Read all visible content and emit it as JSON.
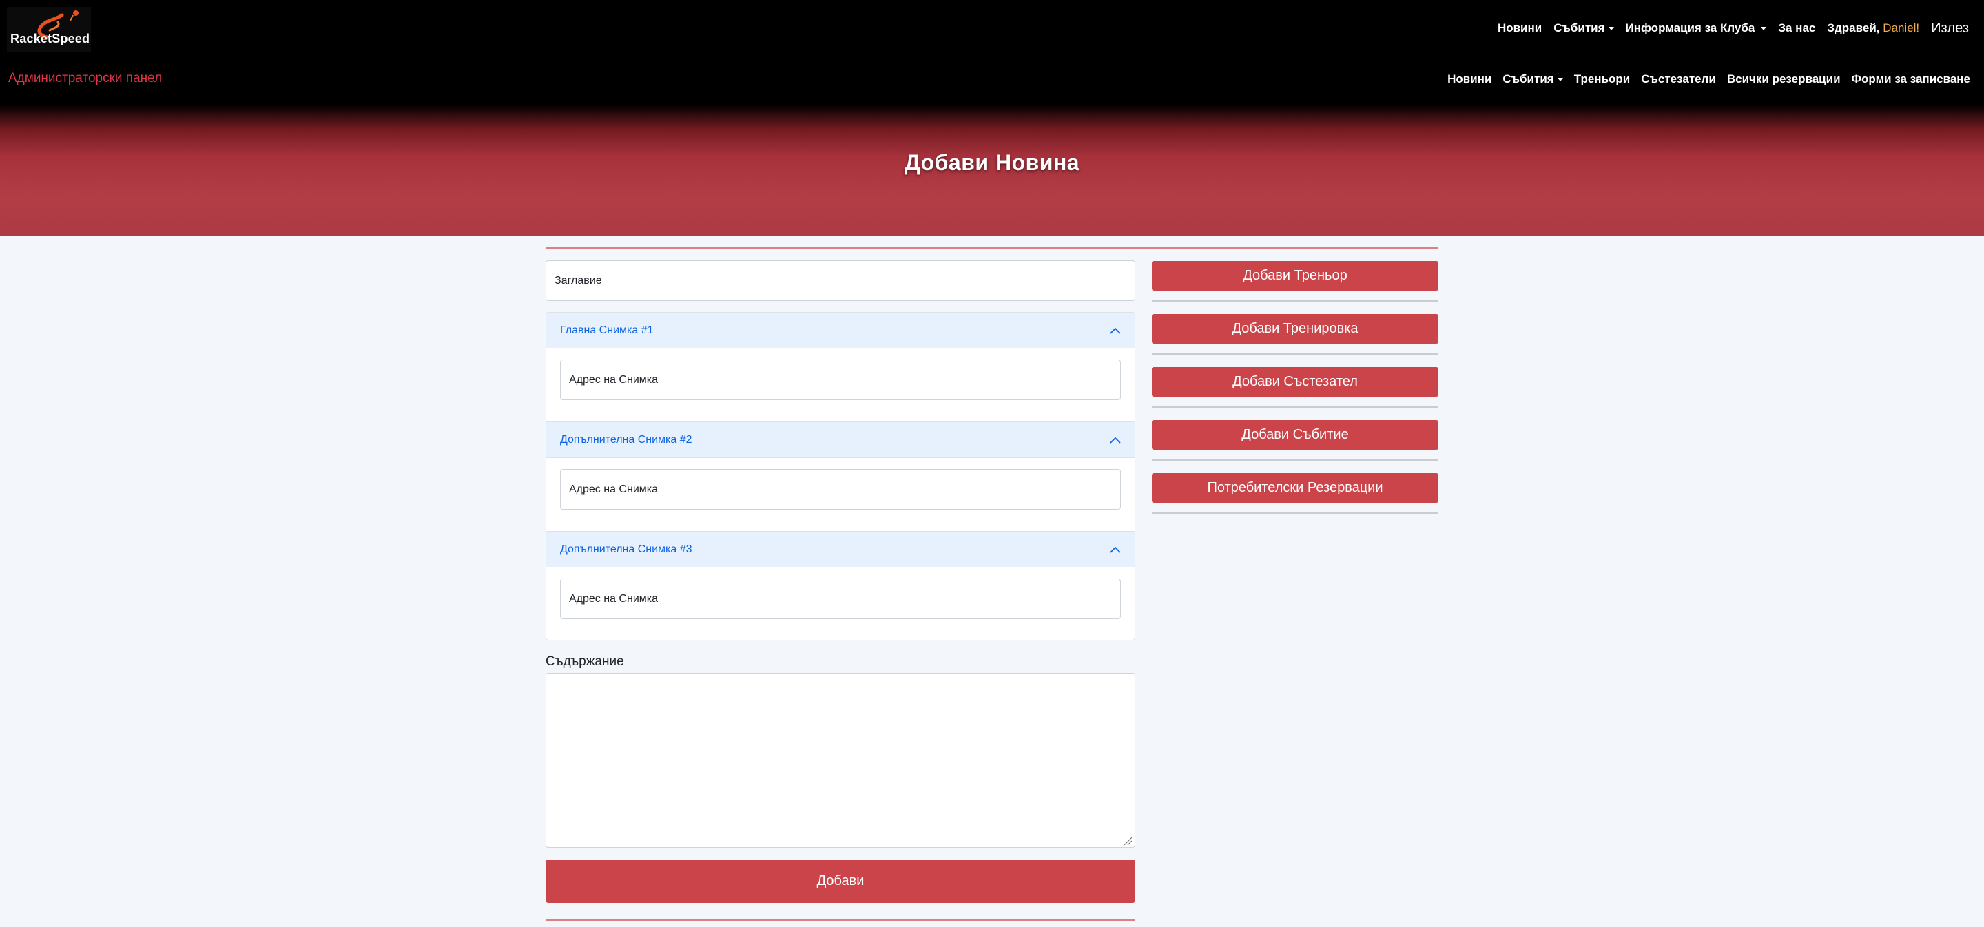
{
  "brand": {
    "logo_text": "RacketSpeed"
  },
  "top_nav": {
    "items": [
      "Новини",
      "Събития",
      "Информация за Клуба",
      "За нас"
    ],
    "greeting": "Здравей,",
    "username": "Daniel!",
    "logout": "Излез"
  },
  "admin_nav": {
    "title": "Администраторски панел",
    "items": [
      "Новини",
      "Събития",
      "Треньори",
      "Състезатели",
      "Всички резервации",
      "Форми за записване"
    ]
  },
  "hero": {
    "title": "Добави Новина"
  },
  "form": {
    "title_placeholder": "Заглавие",
    "images": [
      {
        "header": "Главна Снимка #1",
        "placeholder": "Адрес на Снимка"
      },
      {
        "header": "Допълнителна Снимка #2",
        "placeholder": "Адрес на Снимка"
      },
      {
        "header": "Допълнителна Снимка #3",
        "placeholder": "Адрес на Снимка"
      }
    ],
    "content_label": "Съдържание",
    "submit_label": "Добави"
  },
  "sidebar": {
    "buttons": [
      "Добави Треньор",
      "Добави Тренировка",
      "Добави Състезател",
      "Добави Събитие",
      "Потребителски Резервации"
    ]
  },
  "colors": {
    "accent": "#cb444a",
    "admin_label": "#dc3545",
    "username": "#f0ad4e",
    "accordion_header_bg": "#e7f0fd",
    "accordion_header_text": "#0c63e4"
  }
}
